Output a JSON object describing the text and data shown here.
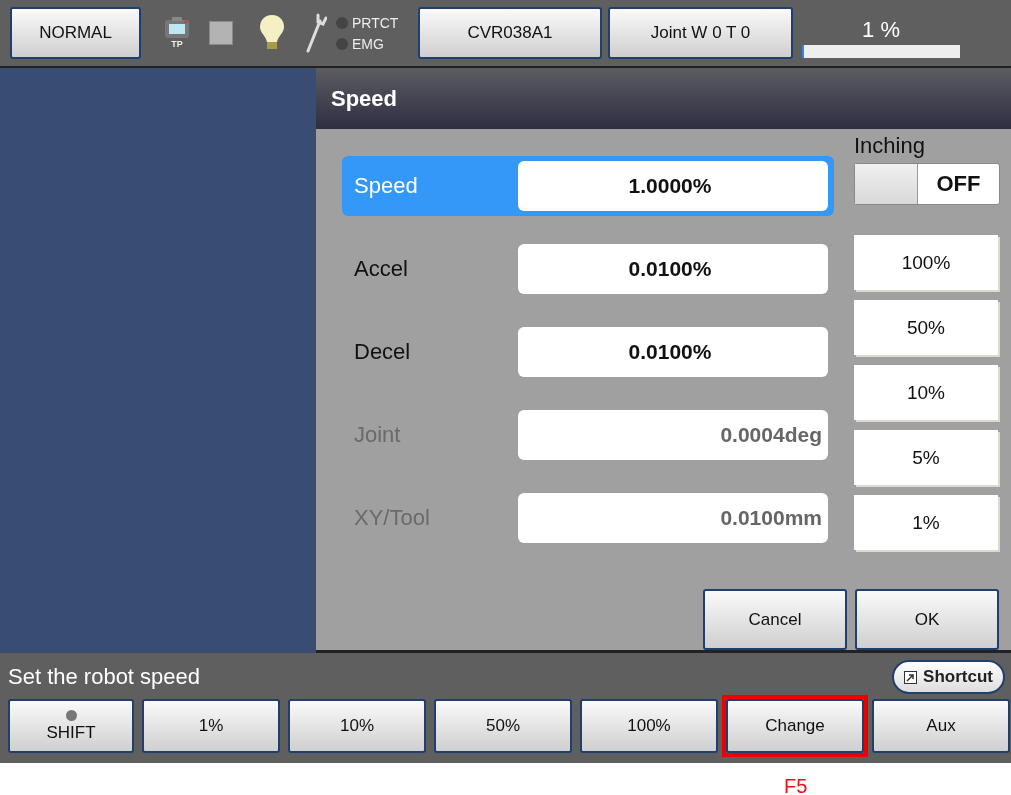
{
  "top_bar": {
    "mode_button": "NORMAL",
    "tp_label": "TP",
    "indicators": [
      {
        "label": "PRTCT",
        "on": false
      },
      {
        "label": "EMG",
        "on": false
      }
    ],
    "robot_button": "CVR038A1",
    "coord_button": "Joint W 0 T 0",
    "speed_reading": "1 %",
    "speed_bar": {
      "level": 0.01
    }
  },
  "dialog": {
    "title": "Speed",
    "rows": [
      {
        "label": "Speed",
        "value": "1.0000%",
        "selected": true,
        "disabled": false
      },
      {
        "label": "Accel",
        "value": "0.0100%",
        "selected": false,
        "disabled": false
      },
      {
        "label": "Decel",
        "value": "0.0100%",
        "selected": false,
        "disabled": false
      },
      {
        "label": "Joint",
        "value": "0.0004deg",
        "selected": false,
        "disabled": true
      },
      {
        "label": "XY/Tool",
        "value": "0.0100mm",
        "selected": false,
        "disabled": true
      }
    ],
    "inching": {
      "label": "Inching",
      "state": "OFF",
      "on": false
    },
    "presets": [
      "100%",
      "50%",
      "10%",
      "5%",
      "1%"
    ],
    "buttons": [
      "Cancel",
      "OK"
    ]
  },
  "status": {
    "message": "Set the robot speed",
    "shortcut": "Shortcut"
  },
  "function_keys": [
    {
      "label": "SHIFT",
      "kind": "shift",
      "highlighted": false
    },
    {
      "label": "1%",
      "kind": "plain",
      "highlighted": false
    },
    {
      "label": "10%",
      "kind": "plain",
      "highlighted": false
    },
    {
      "label": "50%",
      "kind": "plain",
      "highlighted": false
    },
    {
      "label": "100%",
      "kind": "plain",
      "highlighted": false
    },
    {
      "label": "Change",
      "kind": "plain",
      "highlighted": true
    },
    {
      "label": "Aux",
      "kind": "plain",
      "highlighted": false
    }
  ],
  "annotation": "F5"
}
